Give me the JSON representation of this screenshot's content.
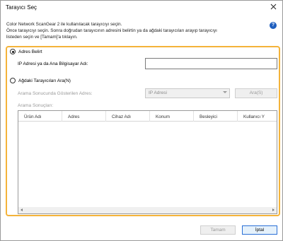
{
  "window": {
    "title": "Tarayıcı Seç"
  },
  "instructions": {
    "line1": "Color Network ScanGear 2 ile kullanılacak tarayıcıyı seçin.",
    "line2": "Önce tarayıcıyı seçin. Sonra doğrudan tarayıcının adresini belirtin ya da ağdaki tarayıcıları arayıp tarayıcıyı",
    "line3": "listeden seçin ve [Tamam]'a tıklayın."
  },
  "address_option": {
    "radio_label": "Adres Belirt",
    "field_label": "IP Adresi ya da Ana Bilgisayar Adı:",
    "field_value": "",
    "selected": true
  },
  "search_option": {
    "radio_label": "Ağdaki Tarayıcıları Ara(N)",
    "address_label": "Arama Sonucunda Gösterilen Adres:",
    "address_select": "IP Adresi",
    "search_button": "Ara(S)",
    "results_label": "Arama Sonuçları:",
    "selected": false
  },
  "results_table": {
    "columns": [
      "Ürün Adı",
      "Adres",
      "Cihaz Adı",
      "Konum",
      "Besleyici",
      "Kullanıcı Y"
    ],
    "rows": []
  },
  "footer": {
    "ok_button": "Tamam",
    "cancel_button": "İptal"
  },
  "colors": {
    "focus_frame": "#f4b33a",
    "primary_border": "#2a6fd6",
    "help_icon": "#1f5fbf"
  }
}
